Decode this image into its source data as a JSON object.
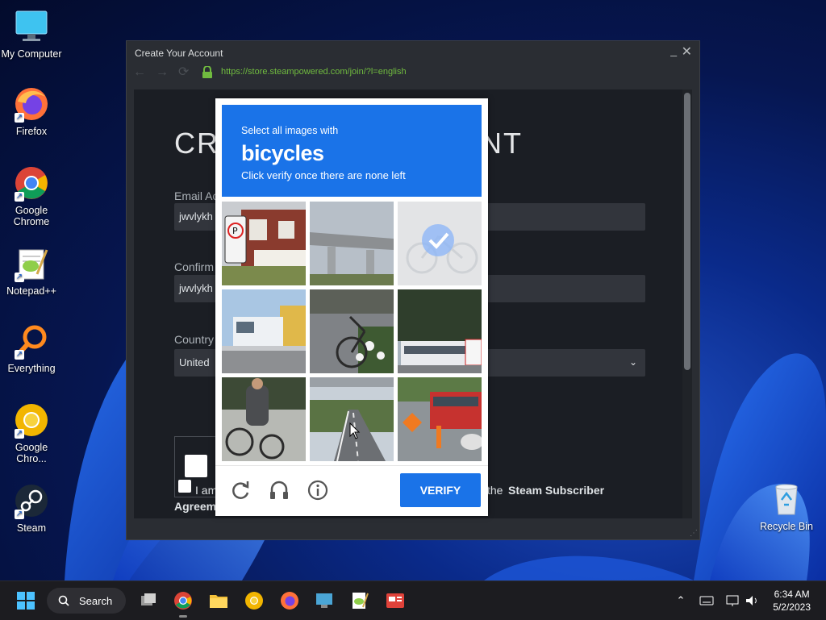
{
  "desktop": {
    "icons": [
      {
        "label": "My Computer",
        "icon": "monitor-icon"
      },
      {
        "label": "Firefox",
        "icon": "firefox-icon"
      },
      {
        "label": "Google Chrome",
        "icon": "chrome-icon"
      },
      {
        "label": "Notepad++",
        "icon": "notepadpp-icon"
      },
      {
        "label": "Everything",
        "icon": "everything-icon"
      },
      {
        "label": "Google Chro...",
        "icon": "chrome-canary-icon"
      },
      {
        "label": "Steam",
        "icon": "steam-icon"
      },
      {
        "label": "Recycle Bin",
        "icon": "recycle-bin-icon"
      }
    ]
  },
  "window": {
    "title": "Create Your Account",
    "url": "https://store.steampowered.com/join/?l=english",
    "page_title": "CRE",
    "page_title_tail": "NT",
    "email_label": "Email Ac",
    "email_value": "jwvlykh",
    "confirm_label": "Confirm",
    "confirm_value": "jwvlykh",
    "country_label": "Country",
    "country_value": "United",
    "agree_prefix": "I am",
    "agree_mid": "the ",
    "agree_link": "Steam Subscriber",
    "agree_line2": "Agreem"
  },
  "captcha": {
    "subtitle": "Select all images with",
    "object": "bicycles",
    "instruction": "Click verify once there are none left",
    "verify_label": "VERIFY",
    "tiles": [
      {
        "desc": "house with no-parking sign",
        "selected": false
      },
      {
        "desc": "overpass",
        "selected": false
      },
      {
        "desc": "bicycle (selected)",
        "selected": true
      },
      {
        "desc": "truck",
        "selected": false
      },
      {
        "desc": "bicycle on sidewalk",
        "selected": false
      },
      {
        "desc": "bus and trees",
        "selected": false
      },
      {
        "desc": "person with bicycle",
        "selected": false
      },
      {
        "desc": "road under bridge",
        "selected": false
      },
      {
        "desc": "bus and traffic cones",
        "selected": false
      }
    ]
  },
  "taskbar": {
    "search_label": "Search",
    "time": "6:34 AM",
    "date": "5/2/2023"
  },
  "colors": {
    "captcha_blue": "#1a73e8",
    "steam_bg": "#1b1e24",
    "url_green": "#70bb3f"
  }
}
